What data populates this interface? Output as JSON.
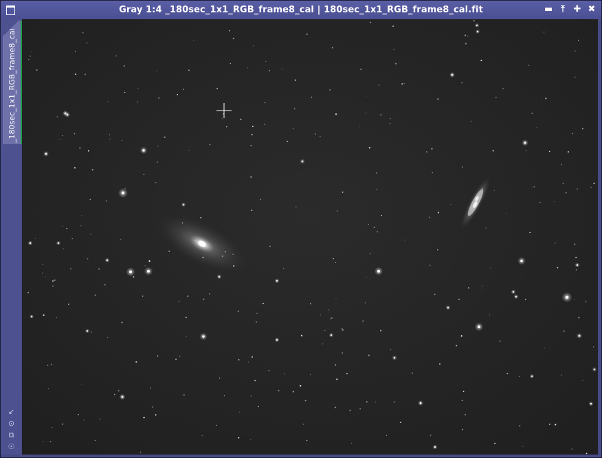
{
  "window": {
    "title": "Gray 1:4 _180sec_1x1_RGB_frame8_cal | 180sec_1x1_RGB_frame8_cal.fit",
    "buttons": {
      "minimize_icon": "minimize-icon",
      "shade_icon": "shade-icon",
      "maximize_icon": "maximize-icon",
      "close_icon": "close-icon"
    }
  },
  "sidebar": {
    "tab_label": "_180sec_1x1_RGB_frame8_cal",
    "tools": [
      "fit-view-icon",
      "zoom-icon",
      "clone-icon",
      "settings-icon"
    ]
  },
  "image": {
    "content": "astrophoto-starfield",
    "objects": [
      "spiral-galaxy",
      "edge-on-galaxy"
    ],
    "colors": {
      "accent": "#4a4e93",
      "tab_indicator": "#1e9b4a",
      "sky_background": "#262626"
    }
  }
}
